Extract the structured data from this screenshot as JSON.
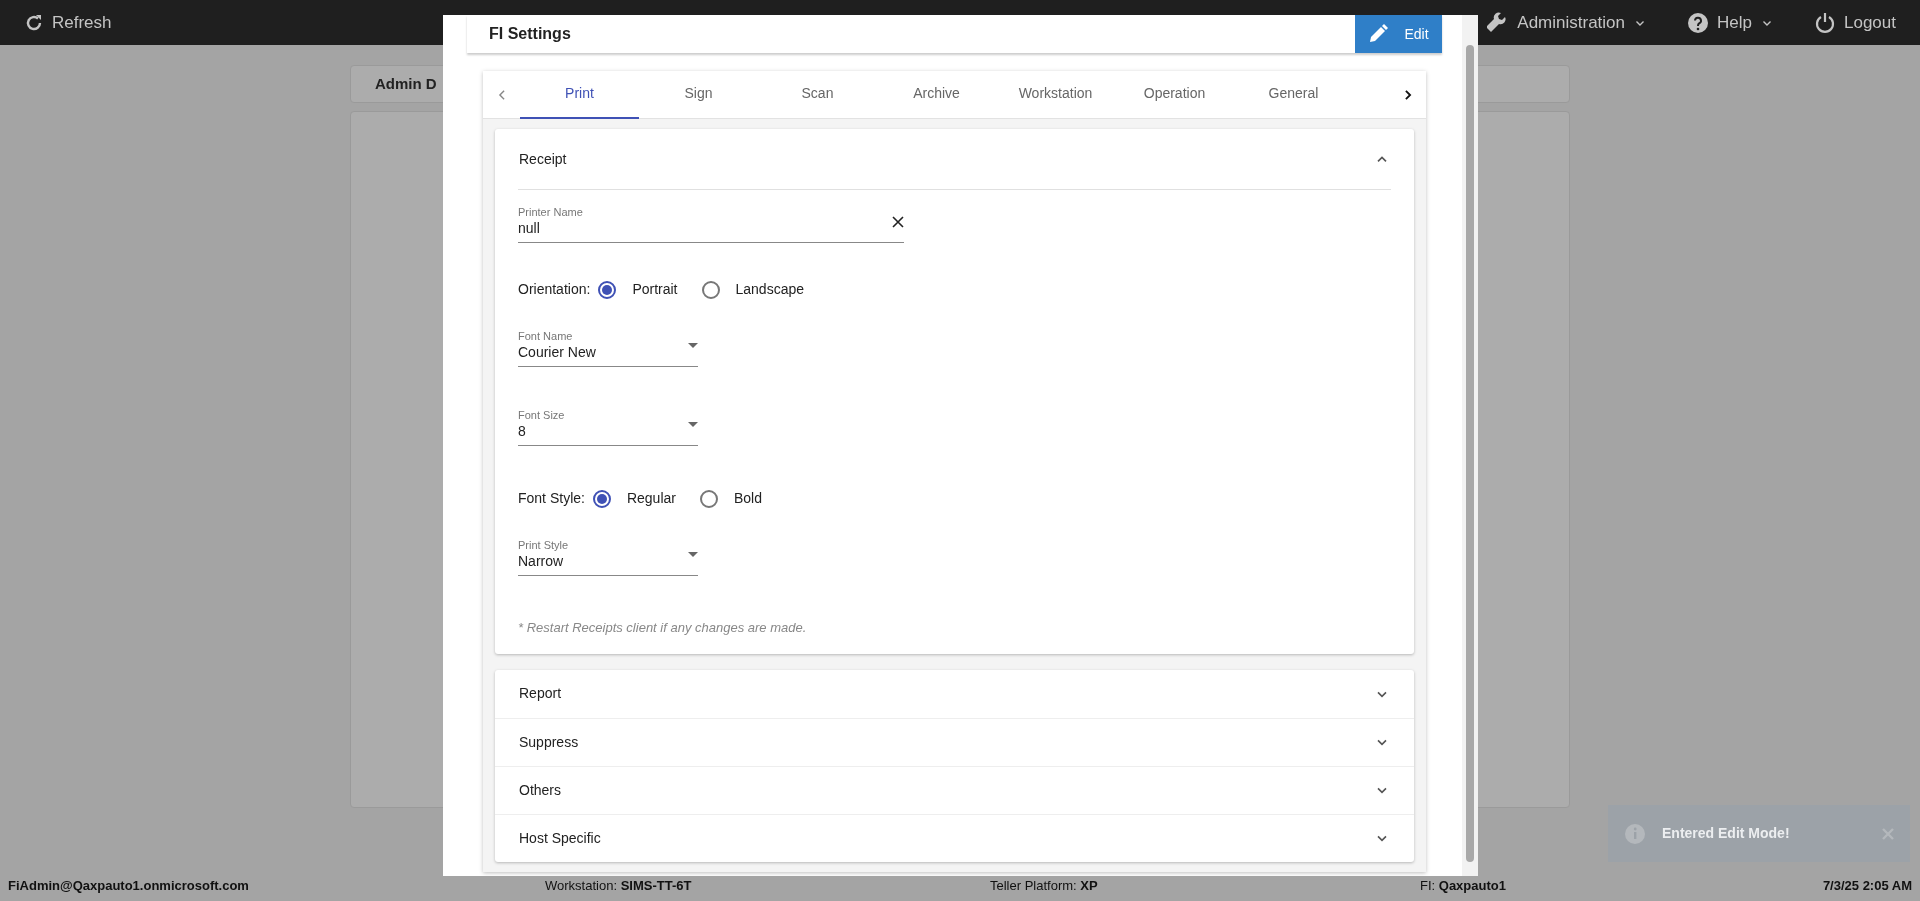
{
  "top_bar": {
    "refresh": "Refresh",
    "menus": [
      {
        "label": "Administration",
        "kind": "dropdown"
      },
      {
        "label": "Help",
        "kind": "dropdown"
      },
      {
        "label": "Logout",
        "kind": "button"
      }
    ]
  },
  "background_page": {
    "header_title": "Admin D"
  },
  "modal": {
    "title": "FI Settings",
    "edit_button": "Edit",
    "tabs": [
      {
        "label": "Print",
        "selected": true
      },
      {
        "label": "Sign",
        "selected": false
      },
      {
        "label": "Scan",
        "selected": false
      },
      {
        "label": "Archive",
        "selected": false
      },
      {
        "label": "Workstation",
        "selected": false
      },
      {
        "label": "Operation",
        "selected": false
      },
      {
        "label": "General",
        "selected": false
      }
    ],
    "sections": [
      {
        "title": "Receipt",
        "expanded": true,
        "items": [
          {
            "kind": "text",
            "label": "Printer Name",
            "value": "null"
          },
          {
            "kind": "radio",
            "label": "Orientation:",
            "options": [
              {
                "label": "Portrait",
                "selected": true
              },
              {
                "label": "Landscape",
                "selected": false
              }
            ]
          },
          {
            "kind": "select",
            "label": "Font Name",
            "value": "Courier New"
          },
          {
            "kind": "select",
            "label": "Font Size",
            "value": "8"
          },
          {
            "kind": "radio",
            "label": "Font Style:",
            "options": [
              {
                "label": "Regular",
                "selected": true
              },
              {
                "label": "Bold",
                "selected": false
              }
            ]
          },
          {
            "kind": "select",
            "label": "Print Style",
            "value": "Narrow"
          },
          {
            "kind": "note",
            "text": "* Restart Receipts client if any changes are made."
          }
        ]
      },
      {
        "title": "Report",
        "expanded": false
      },
      {
        "title": "Suppress",
        "expanded": false
      },
      {
        "title": "Others",
        "expanded": false
      },
      {
        "title": "Host Specific",
        "expanded": false
      }
    ]
  },
  "toast": {
    "message": "Entered Edit Mode!"
  },
  "status_bar": {
    "user": "FiAdmin@Qaxpauto1.onmicrosoft.com",
    "workstation_label": "Workstation:",
    "workstation": "SIMS-TT-6T",
    "platform_label": "Teller Platform:",
    "platform": "XP",
    "fi_label": "FI:",
    "fi": "Qaxpauto1",
    "datetime": "7/3/25 2:05 AM"
  }
}
